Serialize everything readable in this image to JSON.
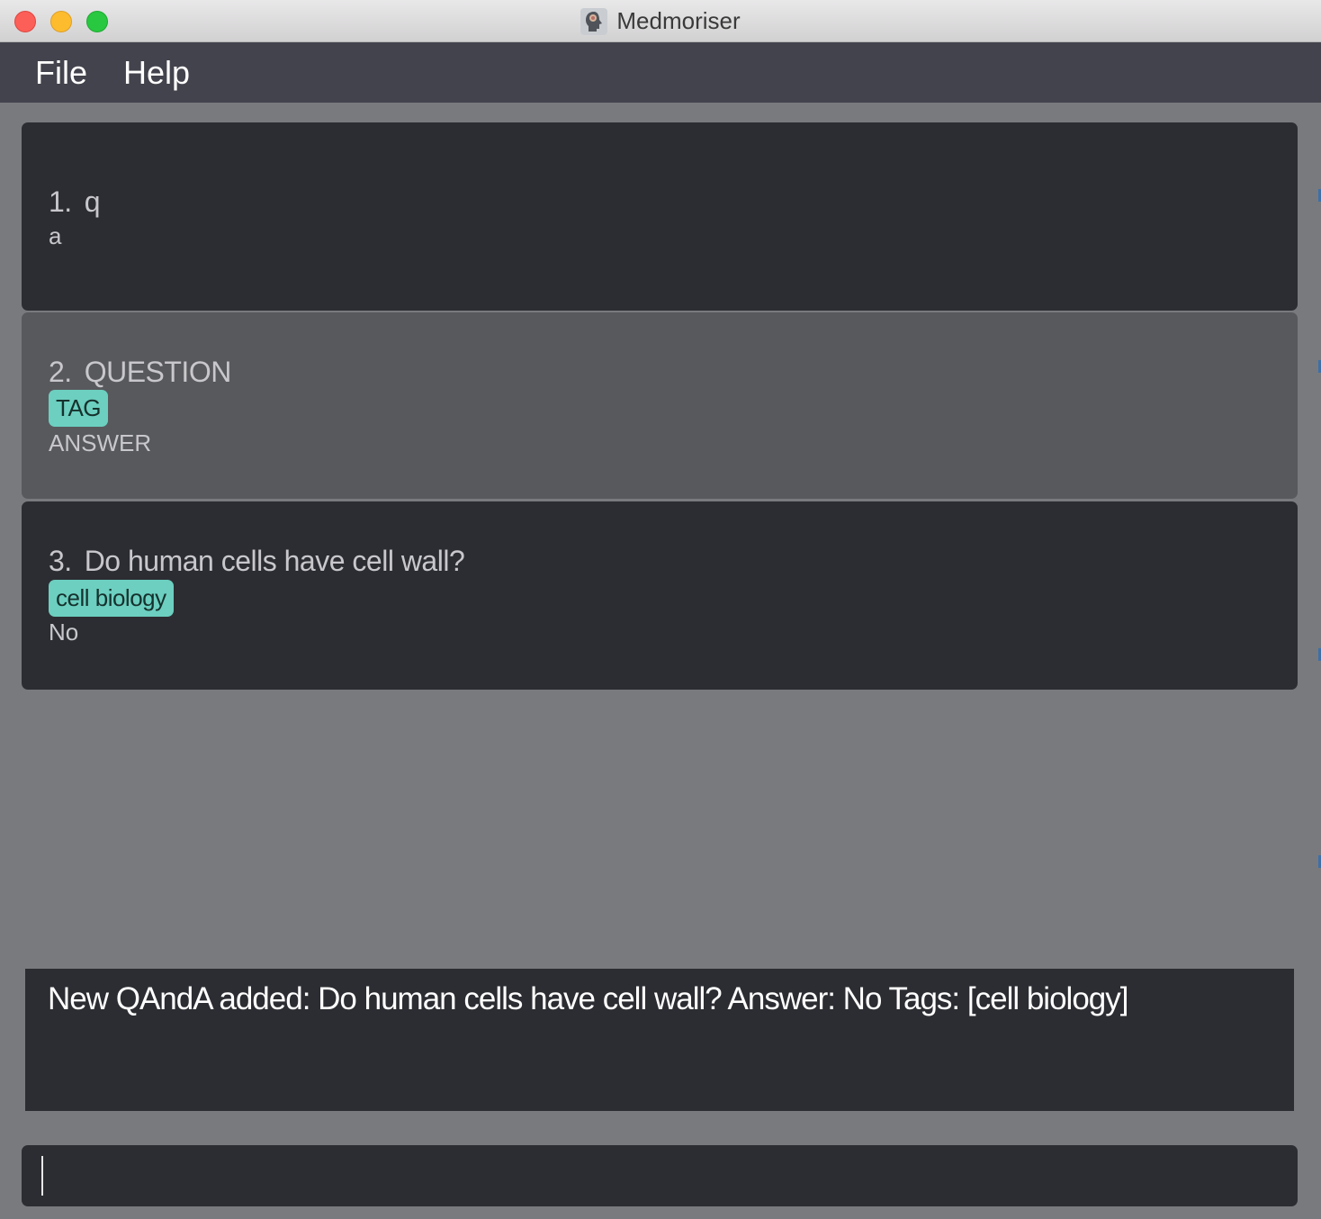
{
  "window": {
    "title": "Medmoriser",
    "icon": "brain-head-icon"
  },
  "menu": {
    "items": [
      {
        "label": "File"
      },
      {
        "label": "Help"
      }
    ]
  },
  "qanda_list": [
    {
      "index": "1.",
      "question": "q",
      "tags": [],
      "answer": "a"
    },
    {
      "index": "2.",
      "question": "QUESTION",
      "tags": [
        "TAG"
      ],
      "answer": "ANSWER"
    },
    {
      "index": "3.",
      "question": "Do human cells have cell wall?",
      "tags": [
        "cell biology"
      ],
      "answer": "No"
    }
  ],
  "result_display": {
    "text": "New QAndA added: Do human cells have cell wall? Answer: No Tags: [cell biology]"
  },
  "command_box": {
    "value": ""
  },
  "colors": {
    "window_bg": "#797a7e",
    "menubar_bg": "#43434d",
    "card_dark": "#2c2d32",
    "card_selected": "#58595d",
    "tag_bg": "#6ccfc0"
  }
}
